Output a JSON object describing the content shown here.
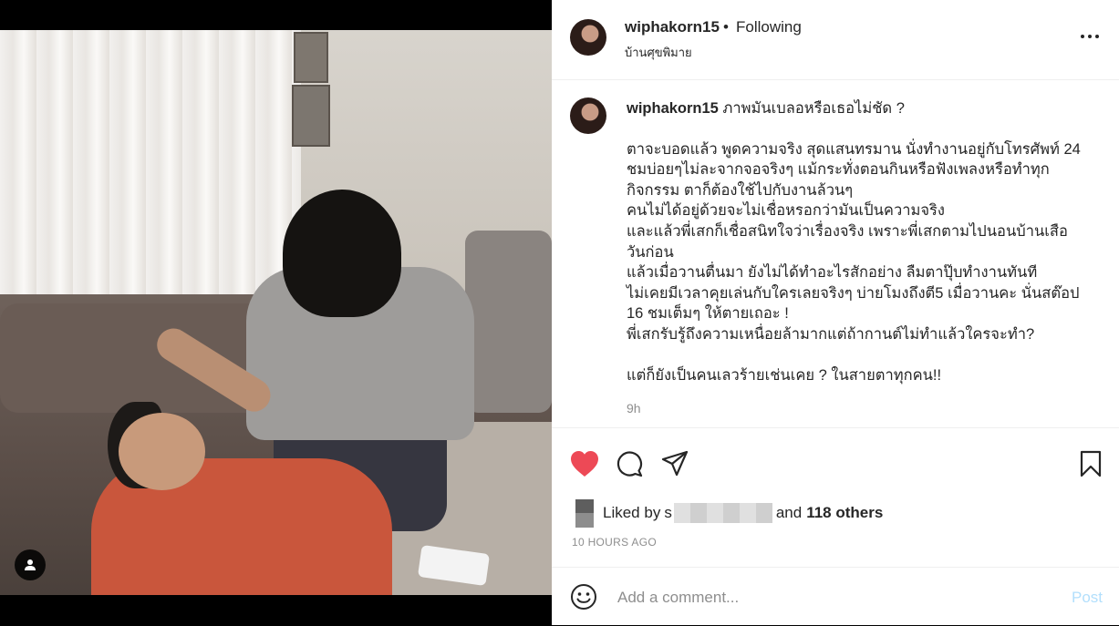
{
  "post": {
    "username": "wiphakorn15",
    "separator": "•",
    "follow_status": "Following",
    "location": "บ้านศุขพิมาย",
    "caption_username": "wiphakorn15",
    "caption_lines": [
      "ภาพมันเบลอหรือเธอไม่ชัด ?",
      "ตาจะบอดแล้ว พูดความจริง สุดแสนทรมาน นั่งทำงานอยู่กับโทรศัพท์ 24",
      "ชมบ่อยๆไม่ละจากจอจริงๆ แม้กระทั่งตอนกินหรือฟังเพลงหรือทำทุก",
      "กิจกรรม ตาก็ต้องใช้ไปกับงานล้วนๆ",
      "คนไม่ได้อยู่ด้วยจะไม่เชื่อหรอกว่ามันเป็นความจริง",
      "และแล้วพี่เสกก็เชื่อสนิทใจว่าเรื่องจริง เพราะพี่เสกตามไปนอนบ้านเสือ",
      "วันก่อน",
      "แล้วเมื่อวานตื่นมา ยังไม่ได้ทำอะไรสักอย่าง ลืมตาปุ๊บทำงานทันที",
      "ไม่เคยมีเวลาคุยเล่นกับใครเลยจริงๆ บ่ายโมงถึงตี5 เมื่อวานคะ นั่นสต๊อป",
      "16 ชมเต็มๆ ให้ตายเถอะ !",
      "พี่เสกรับรู้ถึงความเหนื่อยล้ามากแต่ถ้ากานต์ไม่ทำแล้วใครจะทำ?",
      "แต่ก็ยังเป็นคนเลวร้ายเช่นเคย ? ในสายตาทุกคน!!"
    ],
    "caption_time": "9h",
    "likes_prefix": "Liked by",
    "liker_partial": "s",
    "likes_and": "and",
    "likes_others": "118 others",
    "posted_time": "10 HOURS AGO"
  },
  "comment": {
    "placeholder": "Add a comment...",
    "post_label": "Post"
  },
  "colors": {
    "like_heart": "#ed4956",
    "post_disabled": "#b2dffc",
    "secondary_text": "#8e8e8e"
  },
  "icons": {
    "more": "more-options-icon",
    "like": "heart-icon",
    "comment": "comment-icon",
    "share": "share-icon",
    "save": "bookmark-icon",
    "emoji": "emoji-icon",
    "tag": "user-tag-icon"
  }
}
